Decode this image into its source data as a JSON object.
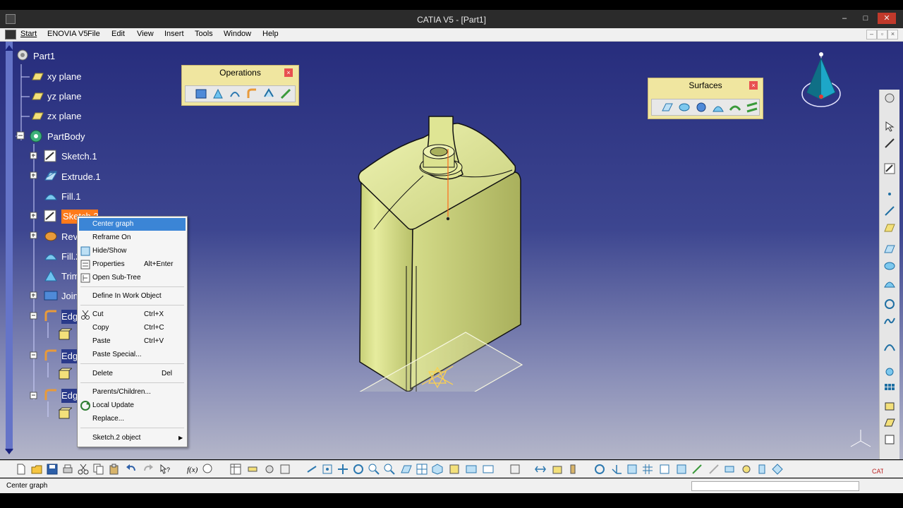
{
  "window": {
    "title": "CATIA V5 - [Part1]"
  },
  "menu": {
    "items": [
      "Start",
      "ENOVIA V5",
      "File",
      "Edit",
      "View",
      "Insert",
      "Tools",
      "Window",
      "Help"
    ]
  },
  "tree": {
    "root": "Part1",
    "items": [
      "xy plane",
      "yz plane",
      "zx plane",
      "PartBody",
      "Sketch.1",
      "Extrude.1",
      "Fill.1",
      "Sketch.2",
      "Revolute.1",
      "Fill.2",
      "Trim.1",
      "Join.1",
      "Edge",
      "Edge",
      "Edge"
    ],
    "selected_index": 7
  },
  "toolbars": {
    "operations": {
      "title": "Operations",
      "close": "×"
    },
    "surfaces": {
      "title": "Surfaces",
      "close": "×"
    }
  },
  "context_menu": {
    "items": [
      {
        "label": "Center graph",
        "shortcut": "",
        "icon": "center-graph-icon",
        "selected": true
      },
      {
        "label": "Reframe On",
        "shortcut": "",
        "icon": ""
      },
      {
        "label": "Hide/Show",
        "shortcut": "",
        "icon": "hide-show-icon"
      },
      {
        "label": "Properties",
        "shortcut": "Alt+Enter",
        "icon": "properties-icon"
      },
      {
        "label": "Open Sub-Tree",
        "shortcut": "",
        "icon": "sub-tree-icon"
      },
      {
        "label": "Define In Work Object",
        "shortcut": "",
        "icon": ""
      },
      {
        "label": "Cut",
        "shortcut": "Ctrl+X",
        "icon": "cut-icon"
      },
      {
        "label": "Copy",
        "shortcut": "Ctrl+C",
        "icon": ""
      },
      {
        "label": "Paste",
        "shortcut": "Ctrl+V",
        "icon": ""
      },
      {
        "label": "Paste Special...",
        "shortcut": "",
        "icon": ""
      },
      {
        "label": "Delete",
        "shortcut": "Del",
        "icon": ""
      },
      {
        "label": "Parents/Children...",
        "shortcut": "",
        "icon": ""
      },
      {
        "label": "Local Update",
        "shortcut": "",
        "icon": "local-update-icon"
      },
      {
        "label": "Replace...",
        "shortcut": "",
        "icon": ""
      },
      {
        "label": "Sketch.2 object",
        "shortcut": "",
        "icon": "",
        "submenu": true
      }
    ]
  },
  "status": {
    "text": "Center graph"
  },
  "colors": {
    "bg_top": "#272d7d",
    "bg_bottom": "#b4b6c9",
    "model": "#d8df8c",
    "selection": "#3b85d6",
    "tree_highlight": "#ff7a1a"
  }
}
